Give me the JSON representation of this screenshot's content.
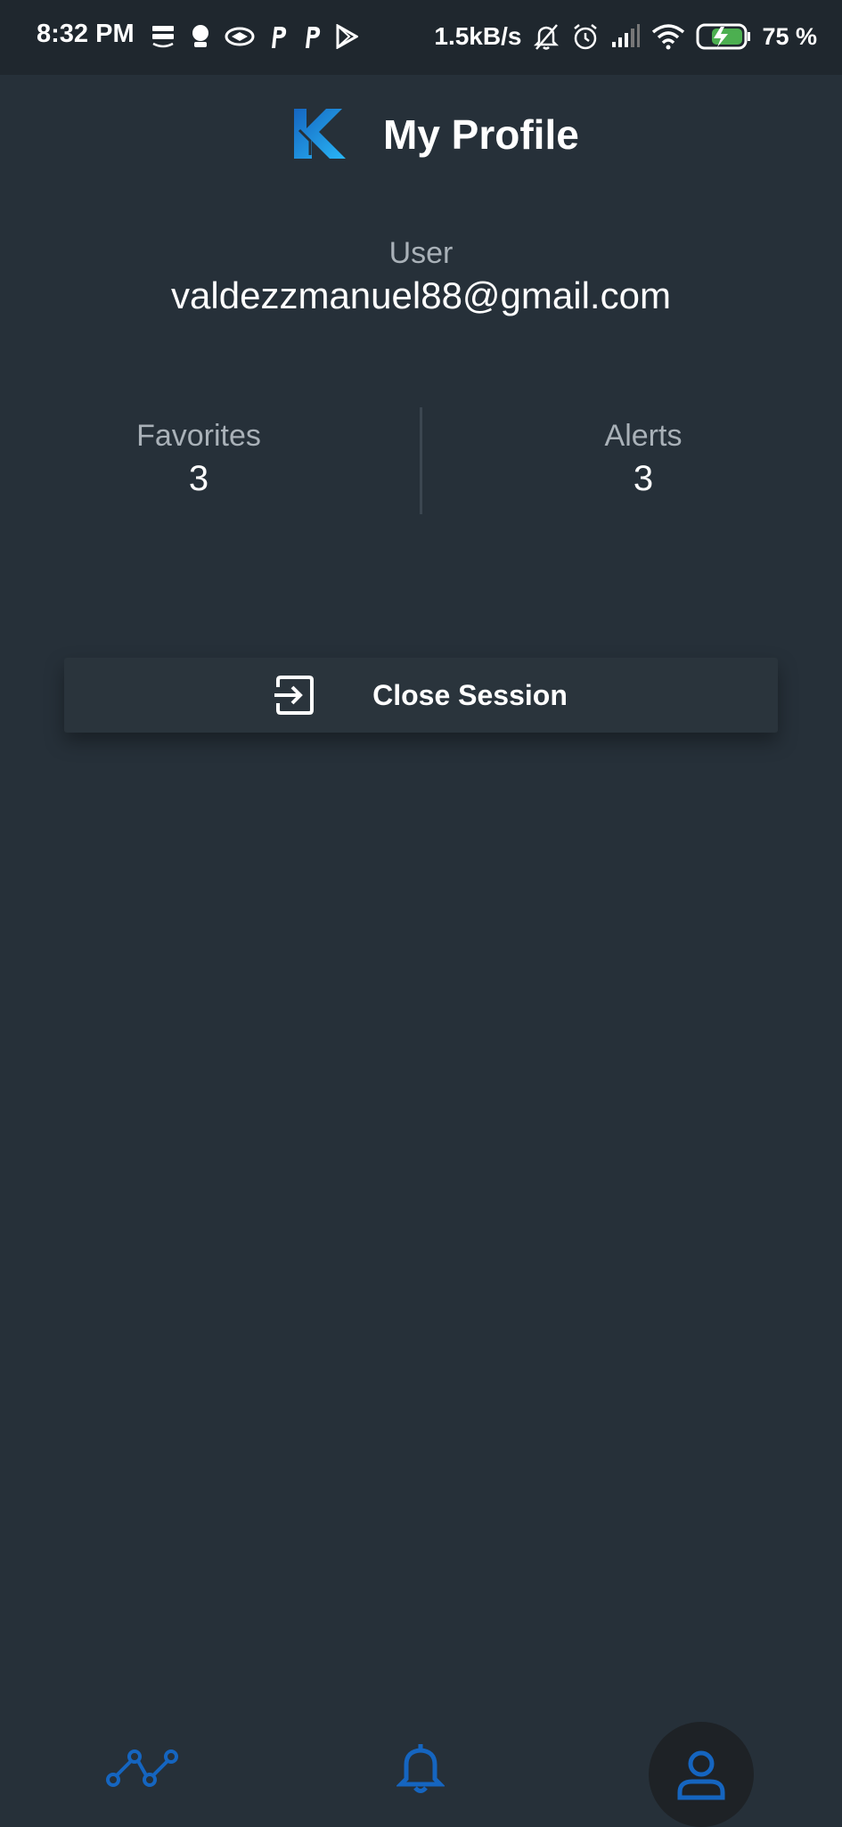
{
  "status_bar": {
    "time": "8:32 PM",
    "network_speed": "1.5kB/s",
    "battery_percent": "75 %",
    "left_icons": [
      "prime-video-icon",
      "chat-icon",
      "handshake-icon",
      "p-app-icon",
      "p-app-icon",
      "play-store-icon"
    ],
    "right_icons": [
      "notifications-off-icon",
      "alarm-icon",
      "signal-icon",
      "wifi-icon",
      "battery-charging-icon"
    ]
  },
  "header": {
    "title": "My Profile",
    "logo_icon": "k-logo-icon"
  },
  "profile": {
    "user_label": "User",
    "user_email": "valdezzmanuel88@gmail.com"
  },
  "stats": {
    "favorites": {
      "label": "Favorites",
      "value": "3"
    },
    "alerts": {
      "label": "Alerts",
      "value": "3"
    }
  },
  "actions": {
    "close_session_label": "Close Session",
    "close_session_icon": "exit-icon"
  },
  "bottom_nav": {
    "items": [
      {
        "icon": "trend-line-icon",
        "active": false
      },
      {
        "icon": "bell-icon",
        "active": false
      },
      {
        "icon": "person-icon",
        "active": true
      }
    ]
  },
  "colors": {
    "background": "#263039",
    "status_bar": "#1f272e",
    "accent_blue": "#1565c0",
    "logo_blue": "#1e88e5",
    "logo_cyan": "#29b6f6",
    "muted_text": "#a9b1b8",
    "battery_green": "#4caf50"
  }
}
